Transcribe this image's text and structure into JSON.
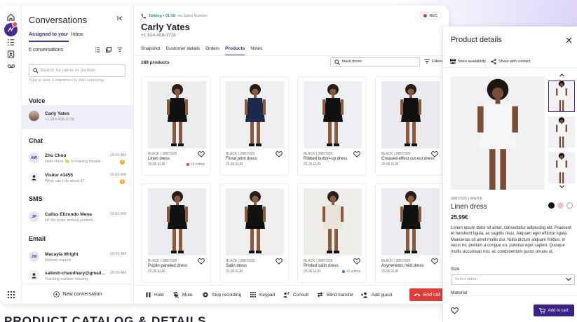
{
  "sidebar": {
    "title": "Conversations",
    "tabs": [
      {
        "label": "Assigned to you",
        "dot": "•"
      },
      {
        "label": "Inbox"
      }
    ],
    "count_label": "6 conversations",
    "search": {
      "placeholder": "Search for name or number",
      "hint": "Type at least 3 characters to start searching"
    },
    "sections": {
      "voice": {
        "title": "Voice",
        "items": [
          {
            "name": "Carly Yates",
            "sub": "+1 814-458-3728"
          }
        ]
      },
      "chat": {
        "title": "Chat",
        "items": [
          {
            "initials": "AW",
            "name": "Zhu Chou",
            "sub": "Hello there 👋 I'm having trouble...",
            "time": "10:50 AM",
            "unread": "1"
          },
          {
            "name": "Visitor #3455",
            "sub": "What can I do about it?",
            "time": "10:50 AM",
            "unread": "1"
          }
        ]
      },
      "sms": {
        "title": "SMS",
        "items": [
          {
            "initials": "JP",
            "name": "Caifas Elizondo Mena",
            "sub": "Hi! My order arrived yesterd...",
            "time": "10:50 AM"
          }
        ]
      },
      "email": {
        "title": "Email",
        "items": [
          {
            "initials": "JM",
            "name": "Macayla Wright",
            "sub": "Refund request",
            "time": "10:50 AM"
          },
          {
            "name": "sailesh-chaudhary@gmail...",
            "sub": "Tracking number missing",
            "time": "10:50 AM"
          }
        ]
      }
    },
    "new_conversation": "New conversation"
  },
  "call": {
    "status": "Talking • 01:58",
    "via": "via Sales Number",
    "rec": "REC",
    "name": "Carly Yates",
    "phone": "+1 814-458-3728"
  },
  "main_tabs": [
    "Snapshot",
    "Customer details",
    "Orders",
    "Products",
    "Notes"
  ],
  "products": {
    "count": "189 products",
    "search_value": "black dress",
    "filters_label": "Filters",
    "items": [
      {
        "meta": "BLACK | 2887/325",
        "name": "Linen dress",
        "price": "25,95 EUR",
        "colors_label": "+3 colors"
      },
      {
        "meta": "BLACK | 2887/325",
        "name": "Floral print dress",
        "price": "25,95 EUR"
      },
      {
        "meta": "BLACK | 2887/325",
        "name": "Ribbed button-up dress",
        "price": "25,95 EUR"
      },
      {
        "meta": "BLACK | 2887/325",
        "name": "Creased-effect cut-out dress",
        "price": "25,95 EUR"
      },
      {
        "meta": "BLACK | 2887/325",
        "name": "Poplin paneled dress",
        "price": "25,95 EUR"
      },
      {
        "meta": "BLACK | 2887/325",
        "name": "Satin dress",
        "price": "25,95 EUR"
      },
      {
        "meta": "BLACK | 2887/325",
        "name": "Printed satin dress",
        "price": "25,95 EUR",
        "colors_label": "+2 colors"
      },
      {
        "meta": "BLACK | 2887/325",
        "name": "Asymmetric midi dress",
        "price": "25,95 EUR"
      }
    ]
  },
  "call_controls": {
    "hold": "Hold",
    "mute": "Mute",
    "stop_recording": "Stop recording",
    "keypad": "Keypad",
    "consult": "Consult",
    "blind_transfer": "Blind transfer",
    "add_guest": "Add guest",
    "end_call": "End call"
  },
  "product_details": {
    "title": "Product details",
    "store_availability": "Store availability",
    "share": "Share with contact",
    "sku": "2887/325 | WHITE",
    "name": "Linen dress",
    "price": "25,99€",
    "description": "Lorem ipsum dolor sit amet, consectetur adipiscing elit. Praesent et hendrerit ligula, ac sagittis risus. Aliquam eget efficitur ligula. Maecenas sit amet mollis dui. Nulla dictum aliquam finibus. In lacus mi, pretium a congue eu, pulvinar eget sapien. Quisque mollis accumsan nisi, ac condimentum purus ornare ut.",
    "size_label": "Size",
    "size_placeholder": "Select option",
    "material_label": "Material",
    "add_to_cart": "Add to cart",
    "swatch_colors": [
      "#111111",
      "#f3c4c4",
      "#ffffff"
    ]
  },
  "colors": {
    "accent": "#4a2a8f",
    "danger": "#e03c3c",
    "talking": "#2e9e55",
    "cart": "#3b2486"
  },
  "bottom_caption": "PRODUCT CATALOG & DETAILS"
}
